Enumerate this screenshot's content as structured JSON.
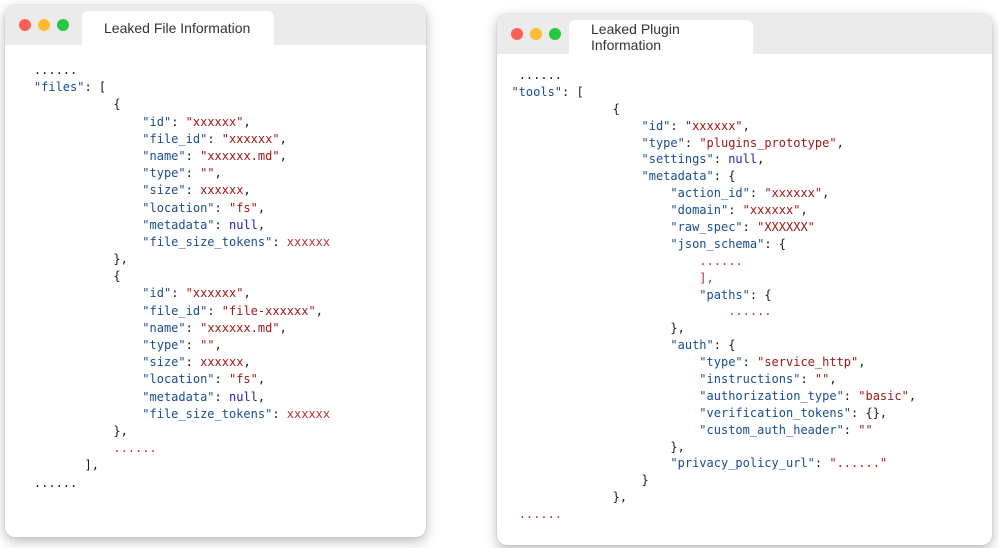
{
  "colors": {
    "close": "#fe5f57",
    "minimize": "#febc2e",
    "zoom": "#28c840",
    "key": "#1a4d8f",
    "string": "#a01818",
    "null": "#2424a8",
    "ellipsis": "#c23030"
  },
  "left_window": {
    "tab_title": "Leaked File Information",
    "lines": [
      {
        "indent": 4,
        "parts": [
          {
            "t": "......",
            "c": "p"
          }
        ]
      },
      {
        "indent": 4,
        "parts": [
          {
            "t": "\"files\"",
            "c": "k"
          },
          {
            "t": ": [",
            "c": "p"
          }
        ]
      },
      {
        "indent": 15,
        "parts": [
          {
            "t": "{",
            "c": "p"
          }
        ]
      },
      {
        "indent": 19,
        "parts": [
          {
            "t": "\"id\"",
            "c": "k"
          },
          {
            "t": ": ",
            "c": "p"
          },
          {
            "t": "\"xxxxxx\"",
            "c": "s"
          },
          {
            "t": ",",
            "c": "p"
          }
        ]
      },
      {
        "indent": 19,
        "parts": [
          {
            "t": "\"file_id\"",
            "c": "k"
          },
          {
            "t": ": ",
            "c": "p"
          },
          {
            "t": "\"xxxxxx\"",
            "c": "s"
          },
          {
            "t": ",",
            "c": "p"
          }
        ]
      },
      {
        "indent": 19,
        "parts": [
          {
            "t": "\"name\"",
            "c": "k"
          },
          {
            "t": ": ",
            "c": "p"
          },
          {
            "t": "\"xxxxxx.md\"",
            "c": "s"
          },
          {
            "t": ",",
            "c": "p"
          }
        ]
      },
      {
        "indent": 19,
        "parts": [
          {
            "t": "\"type\"",
            "c": "k"
          },
          {
            "t": ": ",
            "c": "p"
          },
          {
            "t": "\"\"",
            "c": "s"
          },
          {
            "t": ",",
            "c": "p"
          }
        ]
      },
      {
        "indent": 19,
        "parts": [
          {
            "t": "\"size\"",
            "c": "k"
          },
          {
            "t": ": ",
            "c": "p"
          },
          {
            "t": "xxxxxx",
            "c": "s"
          },
          {
            "t": ",",
            "c": "p"
          }
        ]
      },
      {
        "indent": 19,
        "parts": [
          {
            "t": "\"location\"",
            "c": "k"
          },
          {
            "t": ": ",
            "c": "p"
          },
          {
            "t": "\"fs\"",
            "c": "s"
          },
          {
            "t": ",",
            "c": "p"
          }
        ]
      },
      {
        "indent": 19,
        "parts": [
          {
            "t": "\"metadata\"",
            "c": "k"
          },
          {
            "t": ": ",
            "c": "p"
          },
          {
            "t": "null",
            "c": "n"
          },
          {
            "t": ",",
            "c": "p"
          }
        ]
      },
      {
        "indent": 19,
        "parts": [
          {
            "t": "\"file_size_tokens\"",
            "c": "k"
          },
          {
            "t": ": ",
            "c": "p"
          },
          {
            "t": "xxxxxx",
            "c": "r"
          }
        ]
      },
      {
        "indent": 15,
        "parts": [
          {
            "t": "},",
            "c": "p"
          }
        ]
      },
      {
        "indent": 15,
        "parts": [
          {
            "t": "{",
            "c": "p"
          }
        ]
      },
      {
        "indent": 19,
        "parts": [
          {
            "t": "\"id\"",
            "c": "k"
          },
          {
            "t": ": ",
            "c": "p"
          },
          {
            "t": "\"xxxxxx\"",
            "c": "s"
          },
          {
            "t": ",",
            "c": "p"
          }
        ]
      },
      {
        "indent": 19,
        "parts": [
          {
            "t": "\"file_id\"",
            "c": "k"
          },
          {
            "t": ": ",
            "c": "p"
          },
          {
            "t": "\"file-xxxxxx\"",
            "c": "s"
          },
          {
            "t": ",",
            "c": "p"
          }
        ]
      },
      {
        "indent": 19,
        "parts": [
          {
            "t": "\"name\"",
            "c": "k"
          },
          {
            "t": ": ",
            "c": "p"
          },
          {
            "t": "\"xxxxxx.md\"",
            "c": "s"
          },
          {
            "t": ",",
            "c": "p"
          }
        ]
      },
      {
        "indent": 19,
        "parts": [
          {
            "t": "\"type\"",
            "c": "k"
          },
          {
            "t": ": ",
            "c": "p"
          },
          {
            "t": "\"\"",
            "c": "s"
          },
          {
            "t": ",",
            "c": "p"
          }
        ]
      },
      {
        "indent": 19,
        "parts": [
          {
            "t": "\"size\"",
            "c": "k"
          },
          {
            "t": ": ",
            "c": "p"
          },
          {
            "t": "xxxxxx",
            "c": "s"
          },
          {
            "t": ",",
            "c": "p"
          }
        ]
      },
      {
        "indent": 19,
        "parts": [
          {
            "t": "\"location\"",
            "c": "k"
          },
          {
            "t": ": ",
            "c": "p"
          },
          {
            "t": "\"fs\"",
            "c": "s"
          },
          {
            "t": ",",
            "c": "p"
          }
        ]
      },
      {
        "indent": 19,
        "parts": [
          {
            "t": "\"metadata\"",
            "c": "k"
          },
          {
            "t": ": ",
            "c": "p"
          },
          {
            "t": "null",
            "c": "n"
          },
          {
            "t": ",",
            "c": "p"
          }
        ]
      },
      {
        "indent": 19,
        "parts": [
          {
            "t": "\"file_size_tokens\"",
            "c": "k"
          },
          {
            "t": ": ",
            "c": "p"
          },
          {
            "t": "xxxxxx",
            "c": "r"
          }
        ]
      },
      {
        "indent": 15,
        "parts": [
          {
            "t": "},",
            "c": "p"
          }
        ]
      },
      {
        "indent": 15,
        "parts": [
          {
            "t": "......",
            "c": "r"
          }
        ]
      },
      {
        "indent": 11,
        "parts": [
          {
            "t": "],",
            "c": "p"
          }
        ]
      },
      {
        "indent": 4,
        "parts": [
          {
            "t": "......",
            "c": "p"
          }
        ]
      }
    ]
  },
  "right_window": {
    "tab_title": "Leaked Plugin Information",
    "lines": [
      {
        "indent": 3,
        "parts": [
          {
            "t": "......",
            "c": "p"
          }
        ]
      },
      {
        "indent": 2,
        "parts": [
          {
            "t": "\"tools\"",
            "c": "k"
          },
          {
            "t": ": [",
            "c": "p"
          }
        ]
      },
      {
        "indent": 16,
        "parts": [
          {
            "t": "{",
            "c": "p"
          }
        ]
      },
      {
        "indent": 20,
        "parts": [
          {
            "t": "\"id\"",
            "c": "k"
          },
          {
            "t": ": ",
            "c": "p"
          },
          {
            "t": "\"xxxxxx\"",
            "c": "s"
          },
          {
            "t": ",",
            "c": "p"
          }
        ]
      },
      {
        "indent": 20,
        "parts": [
          {
            "t": "\"type\"",
            "c": "k"
          },
          {
            "t": ": ",
            "c": "p"
          },
          {
            "t": "\"plugins_prototype\"",
            "c": "s"
          },
          {
            "t": ",",
            "c": "p"
          }
        ]
      },
      {
        "indent": 20,
        "parts": [
          {
            "t": "\"settings\"",
            "c": "k"
          },
          {
            "t": ": ",
            "c": "p"
          },
          {
            "t": "null",
            "c": "n"
          },
          {
            "t": ",",
            "c": "p"
          }
        ]
      },
      {
        "indent": 20,
        "parts": [
          {
            "t": "\"metadata\"",
            "c": "k"
          },
          {
            "t": ": {",
            "c": "p"
          }
        ]
      },
      {
        "indent": 24,
        "parts": [
          {
            "t": "\"action_id\"",
            "c": "k"
          },
          {
            "t": ": ",
            "c": "p"
          },
          {
            "t": "\"xxxxxx\"",
            "c": "s"
          },
          {
            "t": ",",
            "c": "p"
          }
        ]
      },
      {
        "indent": 24,
        "parts": [
          {
            "t": "\"domain\"",
            "c": "k"
          },
          {
            "t": ": ",
            "c": "p"
          },
          {
            "t": "\"xxxxxx\"",
            "c": "s"
          },
          {
            "t": ",",
            "c": "p"
          }
        ]
      },
      {
        "indent": 24,
        "parts": [
          {
            "t": "\"raw_spec\"",
            "c": "k"
          },
          {
            "t": ": ",
            "c": "p"
          },
          {
            "t": "\"XXXXXX\"",
            "c": "s"
          }
        ]
      },
      {
        "indent": 24,
        "parts": [
          {
            "t": "\"json_schema\"",
            "c": "k"
          },
          {
            "t": ": {",
            "c": "p"
          }
        ]
      },
      {
        "indent": 28,
        "parts": [
          {
            "t": "......",
            "c": "r"
          }
        ]
      },
      {
        "indent": 28,
        "parts": [
          {
            "t": "],",
            "c": "r"
          }
        ]
      },
      {
        "indent": 28,
        "parts": [
          {
            "t": "\"paths\"",
            "c": "k"
          },
          {
            "t": ": {",
            "c": "p"
          }
        ]
      },
      {
        "indent": 32,
        "parts": [
          {
            "t": "......",
            "c": "r"
          }
        ]
      },
      {
        "indent": 24,
        "parts": [
          {
            "t": "},",
            "c": "p"
          }
        ]
      },
      {
        "indent": 24,
        "parts": [
          {
            "t": "\"auth\"",
            "c": "k"
          },
          {
            "t": ": {",
            "c": "p"
          }
        ]
      },
      {
        "indent": 28,
        "parts": [
          {
            "t": "\"type\"",
            "c": "k"
          },
          {
            "t": ": ",
            "c": "p"
          },
          {
            "t": "\"service_http\"",
            "c": "s"
          },
          {
            "t": ",",
            "c": "p"
          }
        ]
      },
      {
        "indent": 28,
        "parts": [
          {
            "t": "\"instructions\"",
            "c": "k"
          },
          {
            "t": ": ",
            "c": "p"
          },
          {
            "t": "\"\"",
            "c": "s"
          },
          {
            "t": ",",
            "c": "p"
          }
        ]
      },
      {
        "indent": 28,
        "parts": [
          {
            "t": "\"authorization_type\"",
            "c": "k"
          },
          {
            "t": ": ",
            "c": "p"
          },
          {
            "t": "\"basic\"",
            "c": "s"
          },
          {
            "t": ",",
            "c": "p"
          }
        ]
      },
      {
        "indent": 28,
        "parts": [
          {
            "t": "\"verification_tokens\"",
            "c": "k"
          },
          {
            "t": ": {},",
            "c": "p"
          }
        ]
      },
      {
        "indent": 28,
        "parts": [
          {
            "t": "\"custom_auth_header\"",
            "c": "k"
          },
          {
            "t": ": ",
            "c": "p"
          },
          {
            "t": "\"\"",
            "c": "s"
          }
        ]
      },
      {
        "indent": 24,
        "parts": [
          {
            "t": "},",
            "c": "p"
          }
        ]
      },
      {
        "indent": 24,
        "parts": [
          {
            "t": "\"privacy_policy_url\"",
            "c": "k"
          },
          {
            "t": ": ",
            "c": "p"
          },
          {
            "t": "\"......\"",
            "c": "s"
          }
        ]
      },
      {
        "indent": 20,
        "parts": [
          {
            "t": "}",
            "c": "p"
          }
        ]
      },
      {
        "indent": 16,
        "parts": [
          {
            "t": "},",
            "c": "p"
          }
        ]
      },
      {
        "indent": 3,
        "parts": [
          {
            "t": "......",
            "c": "r"
          }
        ]
      }
    ]
  }
}
